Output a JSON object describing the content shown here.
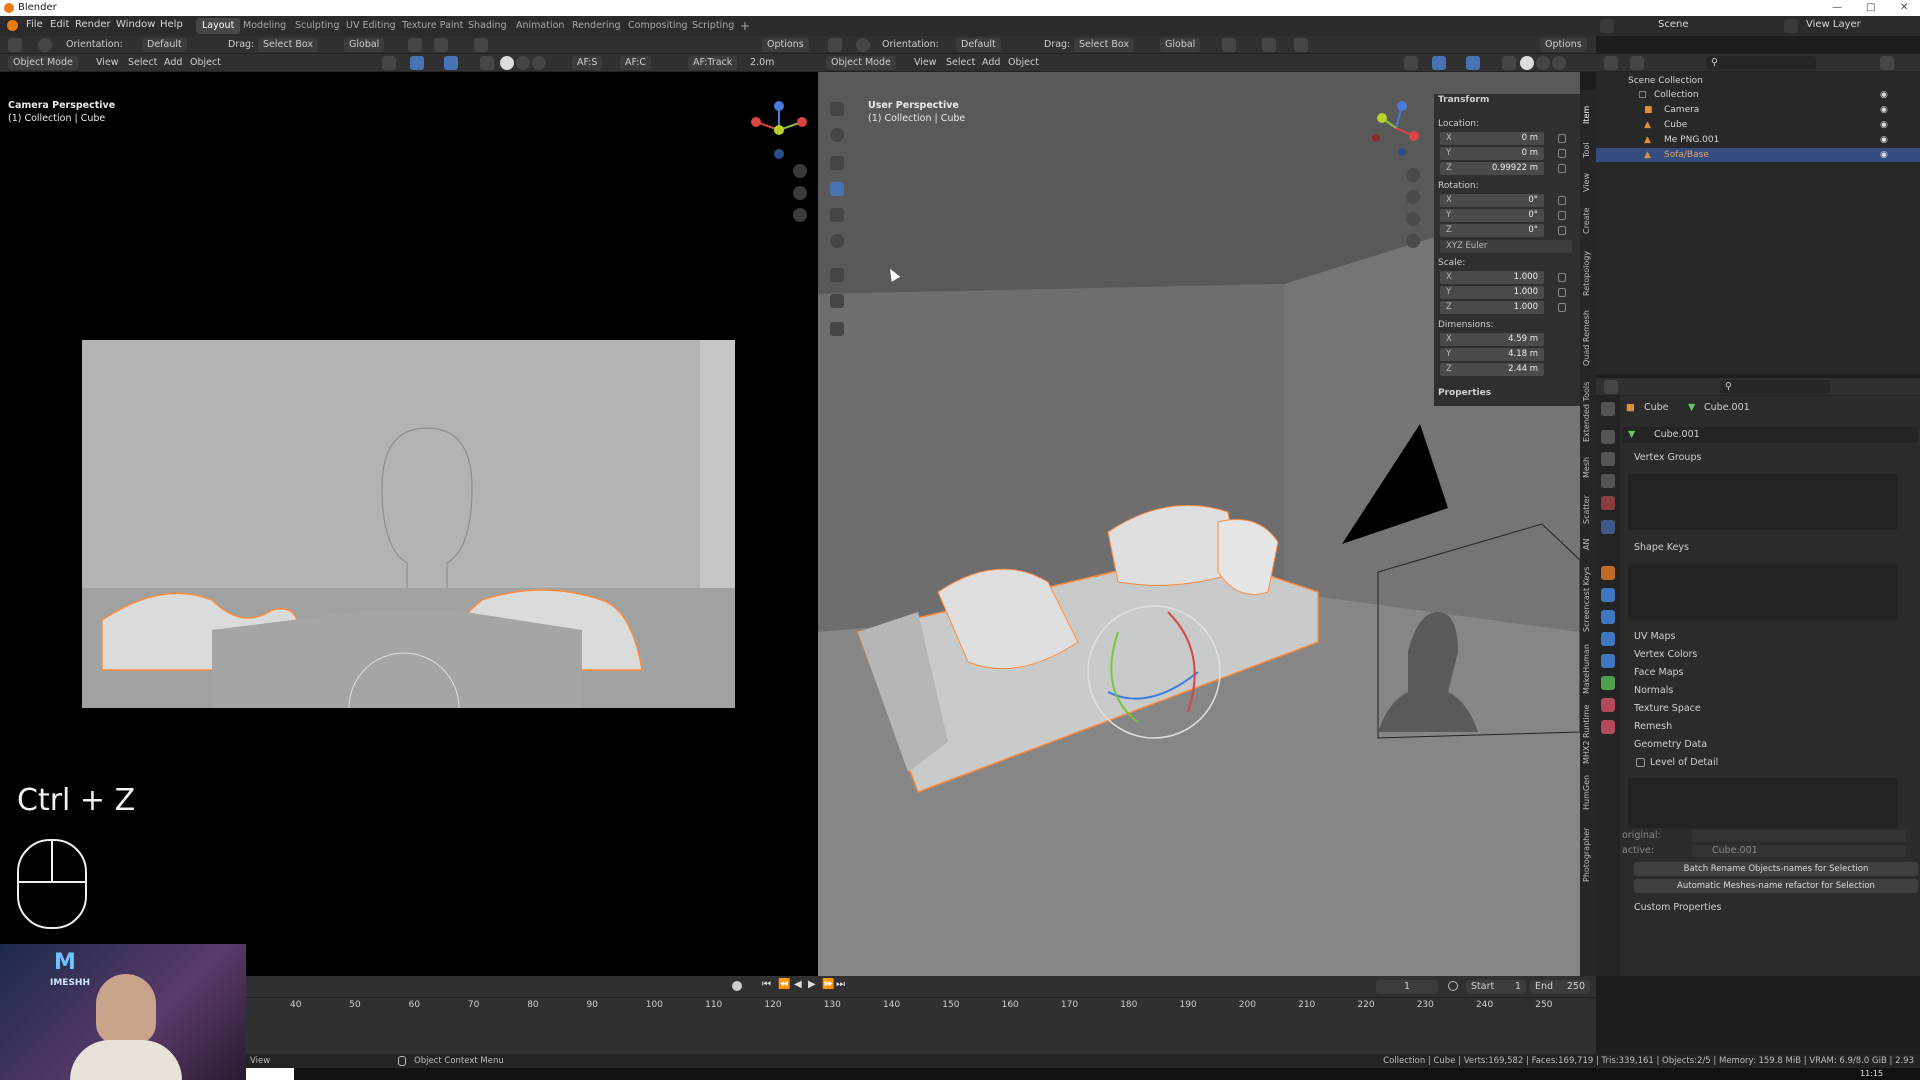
{
  "window": {
    "title": "Blender"
  },
  "menubar": {
    "items": [
      "File",
      "Edit",
      "Render",
      "Window",
      "Help"
    ],
    "workspaces": [
      "Layout",
      "Modeling",
      "Sculpting",
      "UV Editing",
      "Texture Paint",
      "Shading",
      "Animation",
      "Rendering",
      "Compositing",
      "Scripting"
    ],
    "active_workspace": "Layout",
    "scene_label": "Scene",
    "view_layer_label": "View Layer"
  },
  "left_viewport": {
    "header": {
      "orientation_label": "Orientation:",
      "orientation_value": "Default",
      "drag_label": "Drag:",
      "drag_value": "Select Box",
      "transform_value": "Global",
      "options_label": "Options",
      "mode_label": "Object Mode",
      "menus": [
        "View",
        "Select",
        "Add",
        "Object"
      ],
      "af_s": "AF:S",
      "af_c": "AF:C",
      "af_track": "AF:Track",
      "focal": "2.0m"
    },
    "overlay_title": "Camera Perspective",
    "overlay_sub": "(1) Collection | Cube",
    "shortcut_hint": "Ctrl + Z"
  },
  "right_viewport": {
    "header": {
      "orientation_label": "Orientation:",
      "orientation_value": "Default",
      "drag_label": "Drag:",
      "drag_value": "Select Box",
      "transform_value": "Global",
      "options_label": "Options",
      "mode_label": "Object Mode",
      "menus": [
        "View",
        "Select",
        "Add",
        "Object"
      ]
    },
    "overlay_title": "User Perspective",
    "overlay_sub": "(1) Collection | Cube"
  },
  "npanel": {
    "transform_header": "Transform",
    "location_label": "Location:",
    "location": [
      {
        "axis": "X",
        "value": "0 m"
      },
      {
        "axis": "Y",
        "value": "0 m"
      },
      {
        "axis": "Z",
        "value": "0.99922 m"
      }
    ],
    "rotation_label": "Rotation:",
    "rotation": [
      {
        "axis": "X",
        "value": "0°"
      },
      {
        "axis": "Y",
        "value": "0°"
      },
      {
        "axis": "Z",
        "value": "0°"
      }
    ],
    "rotation_mode": "XYZ Euler",
    "scale_label": "Scale:",
    "scale": [
      {
        "axis": "X",
        "value": "1.000"
      },
      {
        "axis": "Y",
        "value": "1.000"
      },
      {
        "axis": "Z",
        "value": "1.000"
      }
    ],
    "dimensions_label": "Dimensions:",
    "dimensions": [
      {
        "axis": "X",
        "value": "4.59 m"
      },
      {
        "axis": "Y",
        "value": "4.18 m"
      },
      {
        "axis": "Z",
        "value": "2.44 m"
      }
    ],
    "properties_header": "Properties"
  },
  "vertical_tabs": [
    "Item",
    "Tool",
    "View",
    "Create",
    "Retopology",
    "Quad Remesh",
    "Extended Tools",
    "Mesh",
    "Scatter",
    "AN",
    "Screencast Keys",
    "MakeHuman",
    "MHX2 Runtime",
    "HumGen",
    "Photographer"
  ],
  "outliner": {
    "root": "Scene Collection",
    "collection": "Collection",
    "items": [
      "Camera",
      "Cube",
      "Me PNG.001",
      "Sofa/Base"
    ],
    "selected_index": 3
  },
  "properties": {
    "object_name": "Cube",
    "mesh_name": "Cube.001",
    "datablock": "Cube.001",
    "sections": {
      "vertex_groups": "Vertex Groups",
      "shape_keys": "Shape Keys",
      "uv_maps": "UV Maps",
      "vertex_colors": "Vertex Colors",
      "face_maps": "Face Maps",
      "normals": "Normals",
      "texture_space": "Texture Space",
      "remesh": "Remesh",
      "geometry_data": "Geometry Data",
      "level_of_detail": "Level of Detail",
      "custom_properties": "Custom Properties"
    },
    "lod_original_label": "original:",
    "lod_active_label": "active:",
    "lod_active_value": "Cube.001",
    "batch_rename_button": "Batch Rename Objects-names for Selection",
    "auto_mesh_button": "Automatic Meshes-name refactor for Selection"
  },
  "timeline": {
    "ticks": [
      "40",
      "50",
      "60",
      "70",
      "80",
      "90",
      "100",
      "110",
      "120",
      "130",
      "140",
      "150",
      "160",
      "170",
      "180",
      "190",
      "200",
      "210",
      "220",
      "230",
      "240",
      "250"
    ],
    "current_frame": "1",
    "start_label": "Start",
    "start_value": "1",
    "end_label": "End",
    "end_value": "250"
  },
  "statusbar": {
    "left": "View",
    "context_menu": "Object Context Menu",
    "right": "Collection | Cube | Verts:169,582 | Faces:169,719 | Tris:339,161 | Objects:2/5 | Memory: 159.8 MiB | VRAM: 6.9/8.0 GiB | 2.93"
  },
  "webcam": {
    "logo": "M",
    "logo_text": "IMESHH"
  },
  "clock": "11:15",
  "colors": {
    "selection_orange": "#ff8a3d",
    "accent_blue": "#4772b3",
    "header_bg": "#303030"
  }
}
